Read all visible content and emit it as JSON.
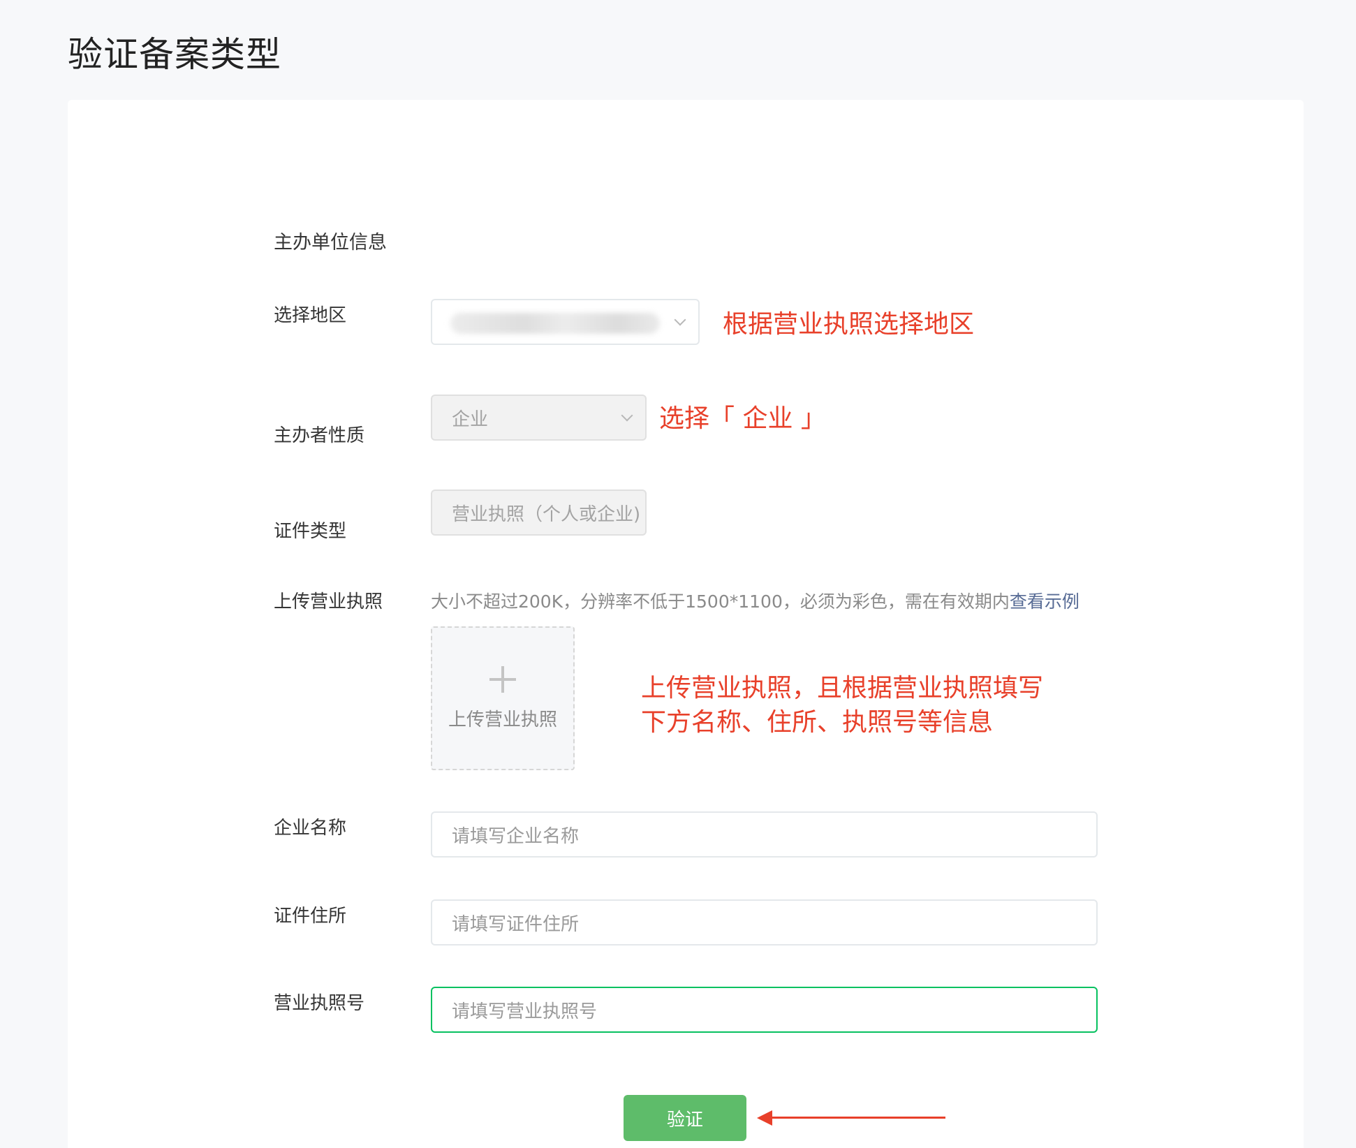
{
  "page": {
    "title": "验证备案类型"
  },
  "form": {
    "section_title": "主办单位信息",
    "region": {
      "label": "选择地区",
      "value": ""
    },
    "nature": {
      "label": "主办者性质",
      "value": "企业"
    },
    "cert_type": {
      "label": "证件类型",
      "value": "营业执照（个人或企业)"
    },
    "upload": {
      "label": "上传营业执照",
      "hint": "大小不超过200K，分辨率不低于1500*1100，必须为彩色，需在有效期内",
      "hint_link": "查看示例",
      "button_text": "上传营业执照"
    },
    "company_name": {
      "label": "企业名称",
      "placeholder": "请填写企业名称"
    },
    "address": {
      "label": "证件住所",
      "placeholder": "请填写证件住所"
    },
    "license_no": {
      "label": "营业执照号",
      "placeholder": "请填写营业执照号"
    },
    "submit_label": "验证"
  },
  "annotations": {
    "region": "根据营业执照选择地区",
    "nature": "选择「 企业 」",
    "upload_line1": "上传营业执照，且根据营业执照填写",
    "upload_line2": "下方名称、住所、执照号等信息"
  },
  "colors": {
    "accent_green": "#07c160",
    "button_green": "#5ebc6a",
    "annotation_red": "#e8402a",
    "link_blue": "#576b95"
  }
}
